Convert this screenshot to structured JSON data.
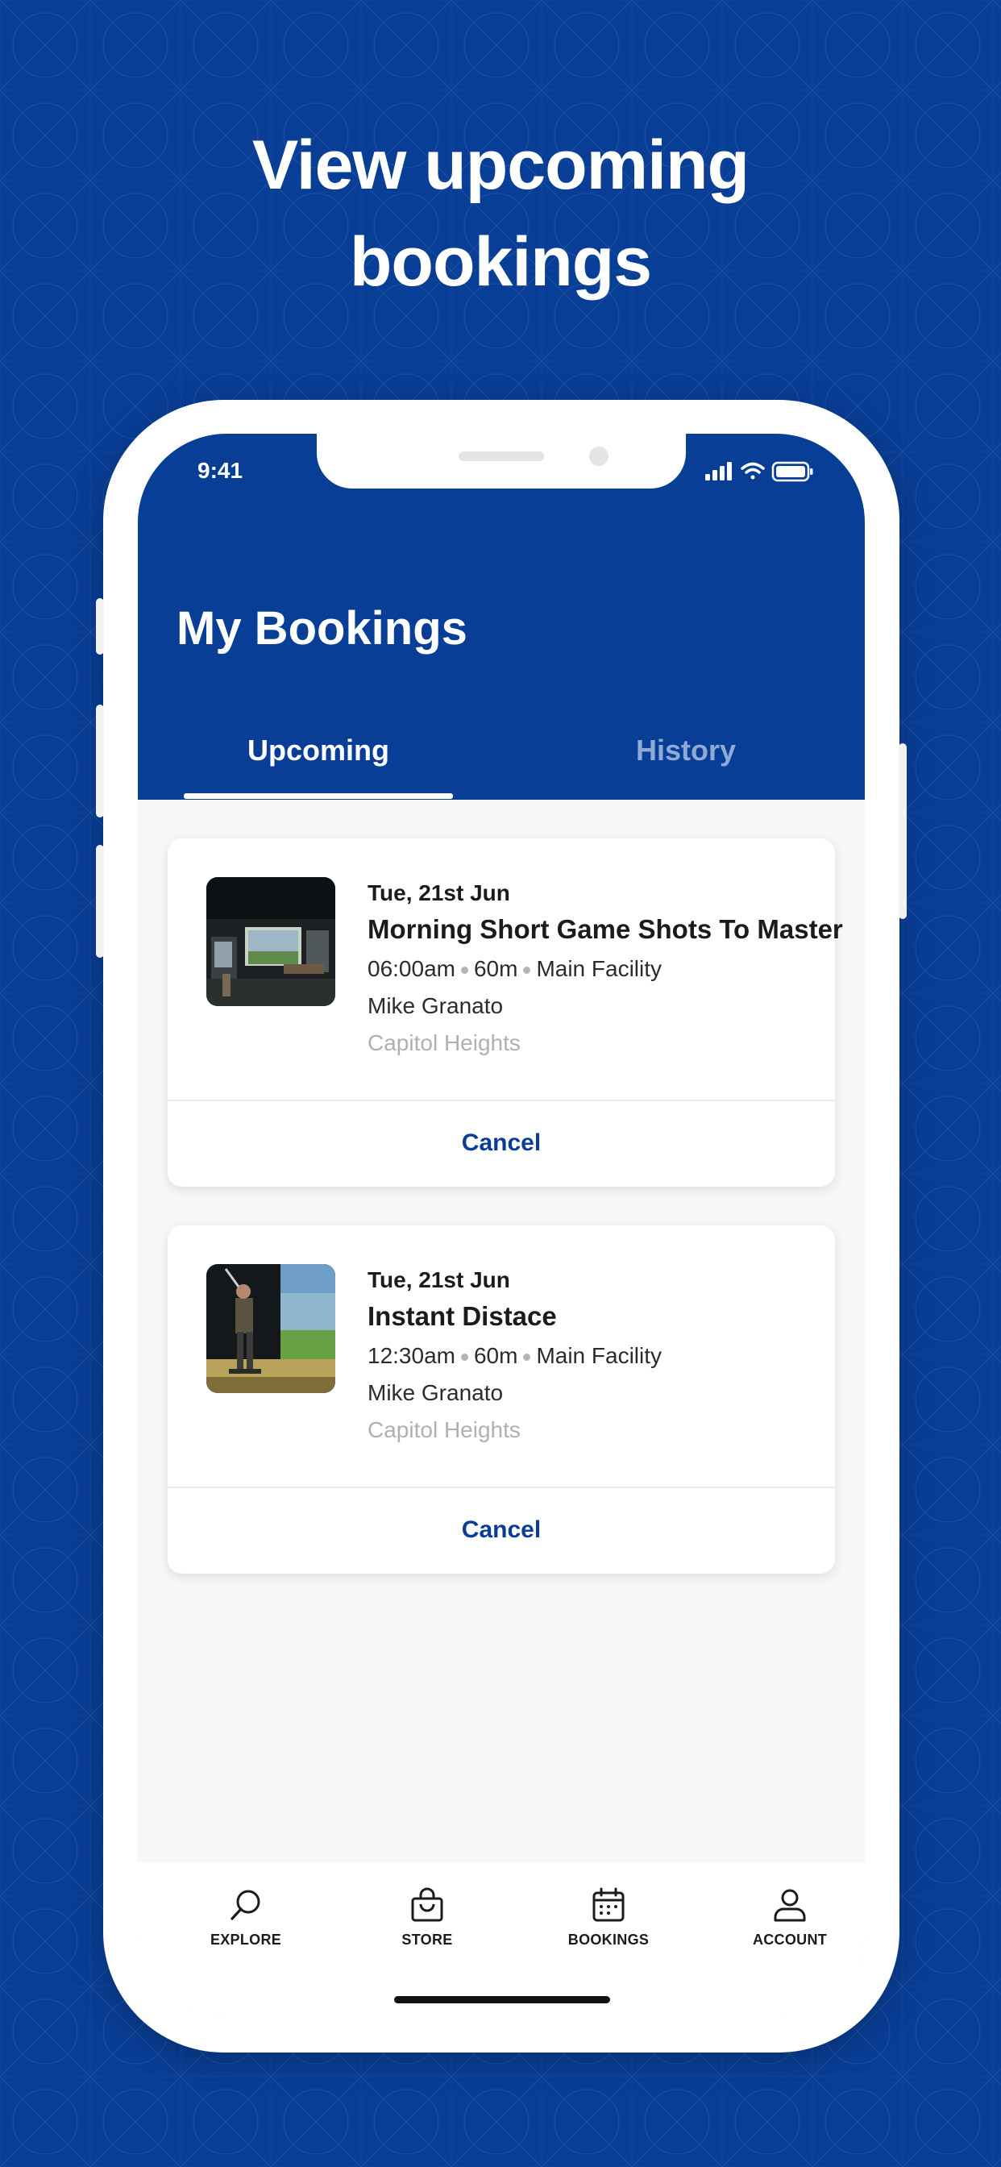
{
  "headline": {
    "line1": "View upcoming",
    "line2": "bookings"
  },
  "status_bar": {
    "time": "9:41",
    "icons": [
      "signal-icon",
      "wifi-icon",
      "battery-icon"
    ]
  },
  "header": {
    "title": "My Bookings"
  },
  "tabs": [
    {
      "label": "Upcoming",
      "active": true
    },
    {
      "label": "History",
      "active": false
    }
  ],
  "bookings": [
    {
      "date": "Tue, 21st Jun",
      "title": "Morning Short Game Shots To Master",
      "time": "06:00am",
      "duration": "60m",
      "facility": "Main Facility",
      "coach": "Mike Granato",
      "location": "Capitol Heights",
      "action": "Cancel",
      "image": "golf-simulator-bay-image"
    },
    {
      "date": "Tue, 21st Jun",
      "title": "Instant Distace",
      "time": "12:30am",
      "duration": "60m",
      "facility": "Main Facility",
      "coach": "Mike Granato",
      "location": "Capitol Heights",
      "action": "Cancel",
      "image": "golfer-swing-image"
    }
  ],
  "nav": [
    {
      "label": "EXPLORE",
      "icon": "search-icon"
    },
    {
      "label": "STORE",
      "icon": "shopping-bag-icon"
    },
    {
      "label": "BOOKINGS",
      "icon": "calendar-icon"
    },
    {
      "label": "ACCOUNT",
      "icon": "user-icon"
    }
  ],
  "colors": {
    "brand": "#093e96",
    "tab_inactive": "#8faad6",
    "muted_text": "#b0b0b0"
  }
}
